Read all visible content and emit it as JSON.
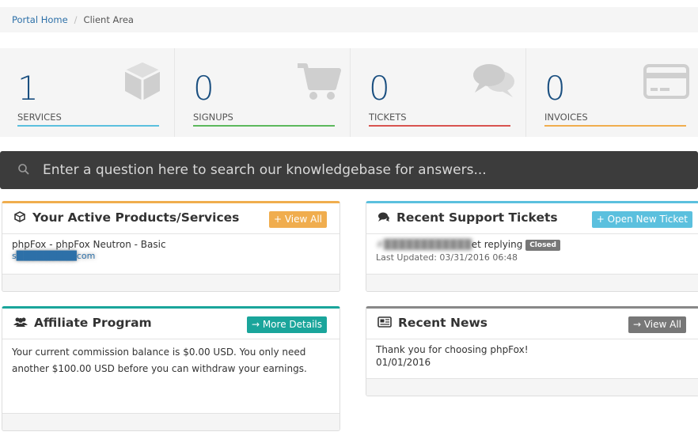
{
  "breadcrumb": {
    "home": "Portal Home",
    "separator": "/",
    "current": "Client Area"
  },
  "stats": [
    {
      "value": "1",
      "label": "SERVICES",
      "icon": "cube-icon",
      "color": "#5bc0de"
    },
    {
      "value": "0",
      "label": "SIGNUPS",
      "icon": "cart-icon",
      "color": "#5cb85c"
    },
    {
      "value": "0",
      "label": "TICKETS",
      "icon": "comments-icon",
      "color": "#d9534f"
    },
    {
      "value": "0",
      "label": "INVOICES",
      "icon": "credit-card-icon",
      "color": "#f0ad4e"
    }
  ],
  "search": {
    "placeholder": "Enter a question here to search our knowledgebase for answers..."
  },
  "panels": {
    "products": {
      "title": "Your Active Products/Services",
      "button": "+ View All",
      "item_name": "phpFox - phpFox Neutron - Basic",
      "item_domain": "s█████████com"
    },
    "tickets": {
      "title": "Recent Support Tickets",
      "button": "+ Open New Ticket",
      "ticket_id": "#████████████",
      "ticket_subject": "et replying",
      "status": "Closed",
      "updated": "Last Updated: 03/31/2016 06:48"
    },
    "affiliate": {
      "title": "Affiliate Program",
      "button": "→ More Details",
      "text": "Your current commission balance is $0.00 USD. You only need another $100.00 USD before you can withdraw your earnings."
    },
    "news": {
      "title": "Recent News",
      "button": "→ View All",
      "item_title": "Thank you for choosing phpFox!",
      "item_date": "01/01/2016"
    }
  },
  "colors": {
    "products_accent": "#f0ad4e",
    "tickets_accent": "#5bc0de",
    "affiliate_accent": "#1aa59b",
    "news_accent": "#888888",
    "search_bg": "#3c3c3c"
  }
}
